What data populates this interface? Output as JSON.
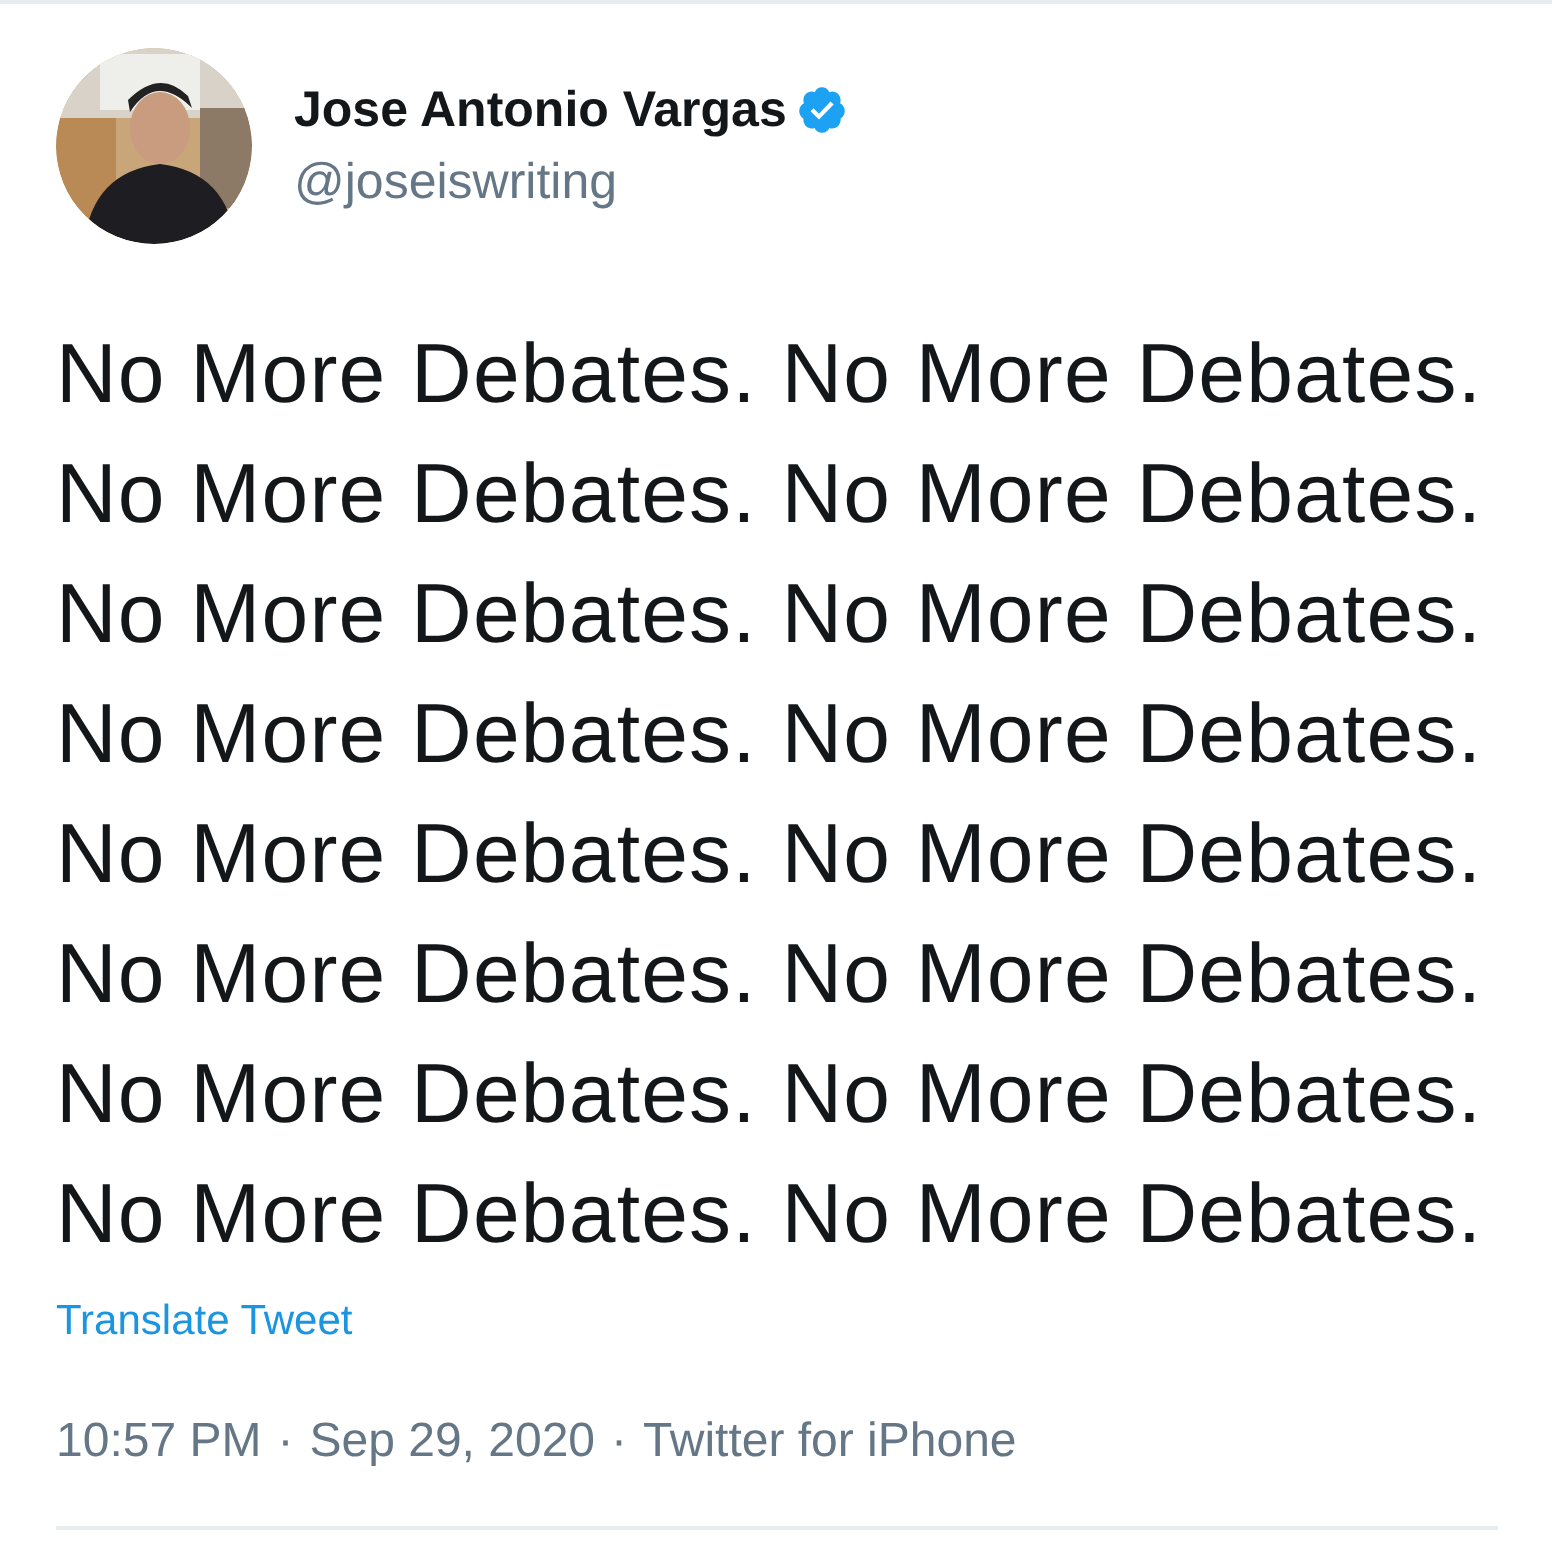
{
  "author": {
    "name": "Jose Antonio Vargas",
    "verified": true,
    "handle": "@joseiswriting"
  },
  "tweet": {
    "text": "No More Debates. No More Debates.\nNo More Debates. No More Debates.\nNo More Debates. No More Debates.\nNo More Debates. No More Debates.\nNo More Debates. No More Debates.\nNo More Debates. No More Debates.\nNo More Debates. No More Debates.\nNo More Debates. No More Debates.",
    "translate_link": "Translate Tweet"
  },
  "meta": {
    "time": "10:57 PM",
    "separator_1": "·",
    "date": "Sep 29, 2020",
    "separator_2": "·",
    "source": "Twitter for iPhone"
  }
}
